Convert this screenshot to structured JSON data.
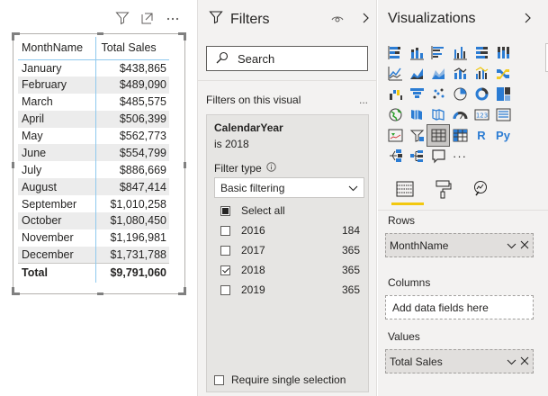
{
  "table": {
    "columns": [
      "MonthName",
      "Total Sales"
    ],
    "rows": [
      {
        "month": "January",
        "sales": "$438,865"
      },
      {
        "month": "February",
        "sales": "$489,090"
      },
      {
        "month": "March",
        "sales": "$485,575"
      },
      {
        "month": "April",
        "sales": "$506,399"
      },
      {
        "month": "May",
        "sales": "$562,773"
      },
      {
        "month": "June",
        "sales": "$554,799"
      },
      {
        "month": "July",
        "sales": "$886,669"
      },
      {
        "month": "August",
        "sales": "$847,414"
      },
      {
        "month": "September",
        "sales": "$1,010,258"
      },
      {
        "month": "October",
        "sales": "$1,080,450"
      },
      {
        "month": "November",
        "sales": "$1,196,981"
      },
      {
        "month": "December",
        "sales": "$1,731,788"
      }
    ],
    "total": {
      "label": "Total",
      "sales": "$9,791,060"
    }
  },
  "filters": {
    "title": "Filters",
    "search_placeholder": "Search",
    "section": "Filters on this visual",
    "section_more": "...",
    "card": {
      "field": "CalendarYear",
      "summary": "is 2018",
      "filter_type_label": "Filter type",
      "filter_type_value": "Basic filtering",
      "select_all": "Select all",
      "options": [
        {
          "label": "2016",
          "count": "184",
          "checked": false
        },
        {
          "label": "2017",
          "count": "365",
          "checked": false
        },
        {
          "label": "2018",
          "count": "365",
          "checked": true
        },
        {
          "label": "2019",
          "count": "365",
          "checked": false
        }
      ],
      "require_single": "Require single selection"
    }
  },
  "viz": {
    "title": "Visualizations",
    "icons": [
      "stacked-bar-chart-icon",
      "stacked-column-chart-icon",
      "clustered-bar-chart-icon",
      "clustered-column-chart-icon",
      "100-stacked-bar-chart-icon",
      "100-stacked-column-chart-icon",
      "line-chart-icon",
      "area-chart-icon",
      "stacked-area-chart-icon",
      "line-and-stacked-column-icon",
      "line-and-clustered-column-icon",
      "ribbon-chart-icon",
      "waterfall-chart-icon",
      "funnel-icon",
      "scatter-chart-icon",
      "pie-chart-icon",
      "donut-chart-icon",
      "treemap-icon",
      "map-icon",
      "filled-map-icon",
      "shape-map-icon",
      "gauge-icon",
      "card-icon",
      "multi-row-card-icon",
      "kpi-icon",
      "slicer-icon",
      "table-icon",
      "matrix-icon",
      "r-visual-icon",
      "python-visual-icon",
      "key-influencers-icon",
      "decomposition-tree-icon",
      "qa-icon",
      "more-visuals-icon"
    ],
    "r_label": "R",
    "py_label": "Py",
    "more_label": "···",
    "wells": {
      "rows_label": "Rows",
      "rows_field": "MonthName",
      "columns_label": "Columns",
      "columns_placeholder": "Add data fields here",
      "values_label": "Values",
      "values_field": "Total Sales"
    }
  }
}
